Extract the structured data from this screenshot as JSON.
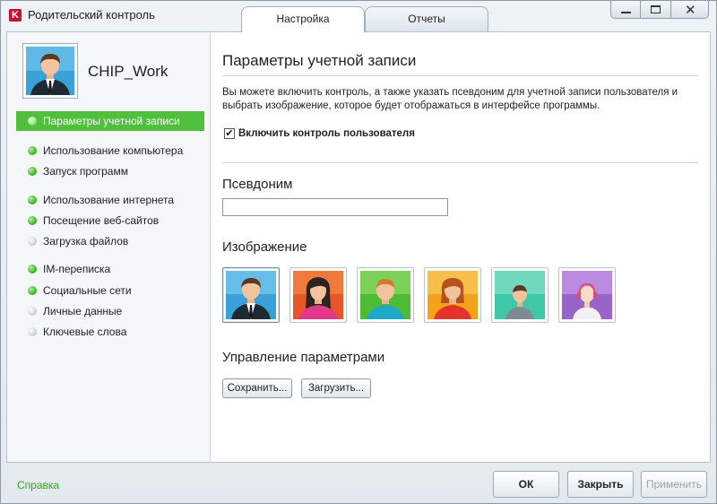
{
  "app": {
    "logo_letter": "K",
    "title": "Родительский контроль",
    "brand_color": "#c8102e"
  },
  "tabs": [
    {
      "label": "Настройка",
      "active": true
    },
    {
      "label": "Отчеты",
      "active": false
    }
  ],
  "user": {
    "name": "CHIP_Work"
  },
  "sidebar": {
    "items": [
      {
        "label": "Параметры учетной записи",
        "status": "active"
      },
      {
        "label": "Использование компьютера",
        "status": "on"
      },
      {
        "label": "Запуск программ",
        "status": "on"
      },
      {
        "label": "Использование интернета",
        "status": "on"
      },
      {
        "label": "Посещение веб-сайтов",
        "status": "on"
      },
      {
        "label": "Загрузка файлов",
        "status": "off"
      },
      {
        "label": "IM-переписка",
        "status": "on"
      },
      {
        "label": "Социальные сети",
        "status": "on"
      },
      {
        "label": "Личные данные",
        "status": "off"
      },
      {
        "label": "Ключевые слова",
        "status": "off"
      }
    ]
  },
  "main": {
    "title": "Параметры учетной записи",
    "description": "Вы можете включить контроль, а также указать псевдоним для учетной записи пользователя и выбрать изображение, которое будет отображаться в интерфейсе программы.",
    "enable_checkbox": {
      "label": "Включить контроль пользователя",
      "checked": true,
      "mark": "✔"
    },
    "alias": {
      "label": "Псевдоним",
      "value": "",
      "placeholder": ""
    },
    "image": {
      "label": "Изображение",
      "options": [
        {
          "bg": "#3aa0d8",
          "icon": "man-in-suit-avatar",
          "selected": true
        },
        {
          "bg": "#e8572a",
          "icon": "woman-dark-hair-avatar"
        },
        {
          "bg": "#4dbb33",
          "icon": "boy-avatar"
        },
        {
          "bg": "#f4a21a",
          "icon": "girl-avatar"
        },
        {
          "bg": "#3fc7a8",
          "icon": "child-avatar"
        },
        {
          "bg": "#9a63c9",
          "icon": "girl-headphones-avatar"
        }
      ]
    },
    "manage": {
      "label": "Управление параметрами",
      "save_label": "Сохранить...",
      "load_label": "Загрузить..."
    }
  },
  "footer": {
    "help_label": "Справка",
    "ok_label": "ОК",
    "close_label": "Закрыть",
    "apply_label": "Применить",
    "apply_enabled": false
  },
  "colors": {
    "accent_green": "#4fbf3c",
    "help_link": "#3aa12a"
  }
}
